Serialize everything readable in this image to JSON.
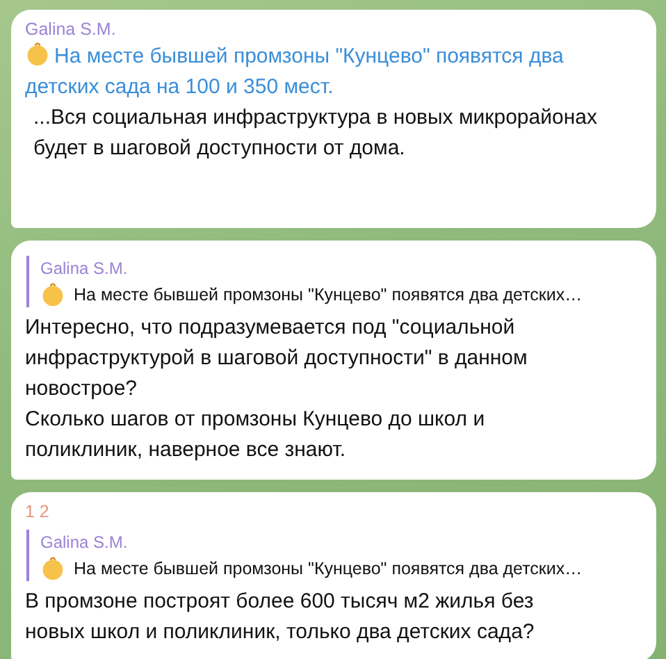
{
  "messages": [
    {
      "sender": {
        "name": "Galina S.M.",
        "color": "#9b82d6"
      },
      "link": "На месте бывшей промзоны \"Кунцево\" появятся два детских сада на 100 и 350 мест.",
      "text": "...Вся социальная инфраструктура в новых микрорайонах будет в шаговой доступности от дома."
    },
    {
      "reply": {
        "author": "Galina S.M.",
        "text": "На месте бывшей промзоны \"Кунцево\" появятся два детских…"
      },
      "text": "Интересно, что подразумевается под \"социальной инфраструктурой в шаговой доступности\" в данном новострое?\nСколько шагов от промзоны Кунцево до школ и поликлиник, наверное все знают."
    },
    {
      "sender": {
        "name": "1 2",
        "color": "#e8957a"
      },
      "reply": {
        "author": "Galina S.M.",
        "text": "На месте бывшей промзоны \"Кунцево\" появятся два детских…"
      },
      "text": "В промзоне построят более 600 тысяч м2 жилья без новых школ и поликлиник, только два детских сада?"
    }
  ]
}
